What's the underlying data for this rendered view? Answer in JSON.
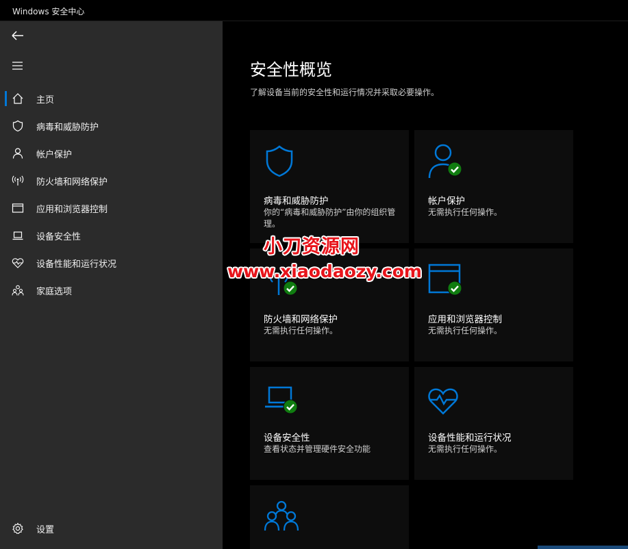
{
  "window": {
    "title": "Windows 安全中心"
  },
  "colors": {
    "accent": "#0078d7",
    "success": "#107c10",
    "watermark": "#e8141b"
  },
  "sidebar": {
    "back_icon": "back-arrow-icon",
    "menu_icon": "hamburger-menu-icon",
    "items": [
      {
        "label": "主页",
        "icon": "home-icon",
        "selected": true
      },
      {
        "label": "病毒和威胁防护",
        "icon": "shield-icon"
      },
      {
        "label": "帐户保护",
        "icon": "person-icon"
      },
      {
        "label": "防火墙和网络保护",
        "icon": "antenna-icon"
      },
      {
        "label": "应用和浏览器控制",
        "icon": "browser-window-icon"
      },
      {
        "label": "设备安全性",
        "icon": "laptop-icon"
      },
      {
        "label": "设备性能和运行状况",
        "icon": "heart-pulse-icon"
      },
      {
        "label": "家庭选项",
        "icon": "family-icon"
      }
    ],
    "settings": {
      "label": "设置",
      "icon": "gear-icon"
    }
  },
  "main": {
    "title": "安全性概览",
    "subtitle": "了解设备当前的安全性和运行情况并采取必要操作。",
    "cards": [
      {
        "title": "病毒和威胁防护",
        "desc": "你的“病毒和威胁防护”由你的组织管理。",
        "icon": "shield-icon",
        "status": "managed"
      },
      {
        "title": "帐户保护",
        "desc": "无需执行任何操作。",
        "icon": "person-icon",
        "status": "ok"
      },
      {
        "title": "防火墙和网络保护",
        "desc": "无需执行任何操作。",
        "icon": "antenna-icon",
        "status": "ok"
      },
      {
        "title": "应用和浏览器控制",
        "desc": "无需执行任何操作。",
        "icon": "browser-window-icon",
        "status": "ok"
      },
      {
        "title": "设备安全性",
        "desc": "查看状态并管理硬件安全功能",
        "icon": "laptop-icon",
        "status": "ok"
      },
      {
        "title": "设备性能和运行状况",
        "desc": "无需执行任何操作。",
        "icon": "heart-pulse-icon",
        "status": "none"
      },
      {
        "title": "",
        "desc": "",
        "icon": "family-icon",
        "status": "none"
      }
    ]
  },
  "watermark": {
    "line1": "小刀资源网",
    "line2": "www.xiaodaozy.com"
  }
}
